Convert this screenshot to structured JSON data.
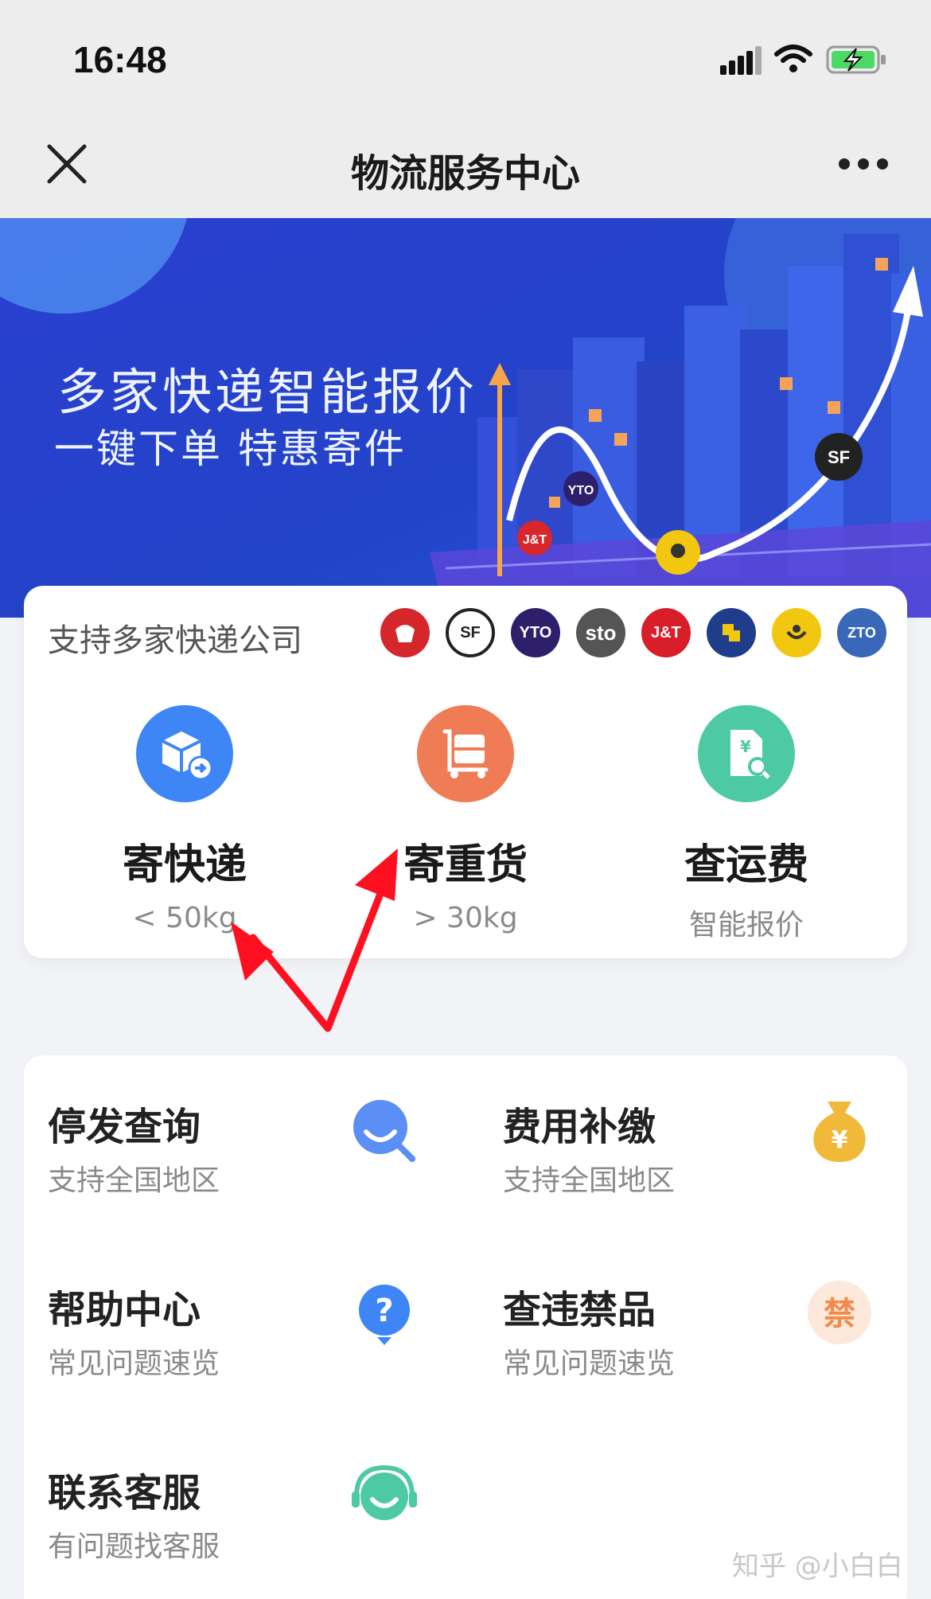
{
  "status": {
    "time": "16:48"
  },
  "nav": {
    "title": "物流服务中心"
  },
  "banner": {
    "title": "多家快递智能报价",
    "subtitle": "一键下单 特惠寄件"
  },
  "carriers": {
    "label": "支持多家快递公司",
    "logos": [
      {
        "text": "",
        "color": "#d5262b"
      },
      {
        "text": "SF",
        "color": "#222222"
      },
      {
        "text": "YTO",
        "color": "#2e1f6b"
      },
      {
        "text": "sto",
        "color": "#333333"
      },
      {
        "text": "J&T",
        "color": "#d71e29"
      },
      {
        "text": "",
        "color": "#1f3d8a"
      },
      {
        "text": "",
        "color": "#f2c70f"
      },
      {
        "text": "ZTO",
        "color": "#3a68b9"
      }
    ]
  },
  "services": [
    {
      "name": "寄快递",
      "sub": "< 50kg",
      "color": "#3e86f5"
    },
    {
      "name": "寄重货",
      "sub": "> 30kg",
      "color": "#ef7c55"
    },
    {
      "name": "查运费",
      "sub": "智能报价",
      "color": "#4dc9a4"
    }
  ],
  "grid": [
    {
      "title": "停发查询",
      "sub": "支持全国地区"
    },
    {
      "title": "费用补缴",
      "sub": "支持全国地区"
    },
    {
      "title": "帮助中心",
      "sub": "常见问题速览"
    },
    {
      "title": "查违禁品",
      "sub": "常见问题速览"
    },
    {
      "title": "联系客服",
      "sub": "有问题找客服"
    }
  ],
  "icons": {
    "stop-query": "search-bubble-icon",
    "fee": "money-bag-icon",
    "help": "question-bubble-icon",
    "prohibited": "forbidden-icon",
    "service": "headset-icon"
  },
  "watermark": "知乎 @小白白",
  "colors": {
    "accent_blue": "#3e86f5",
    "annotation_red": "#ff1020"
  }
}
